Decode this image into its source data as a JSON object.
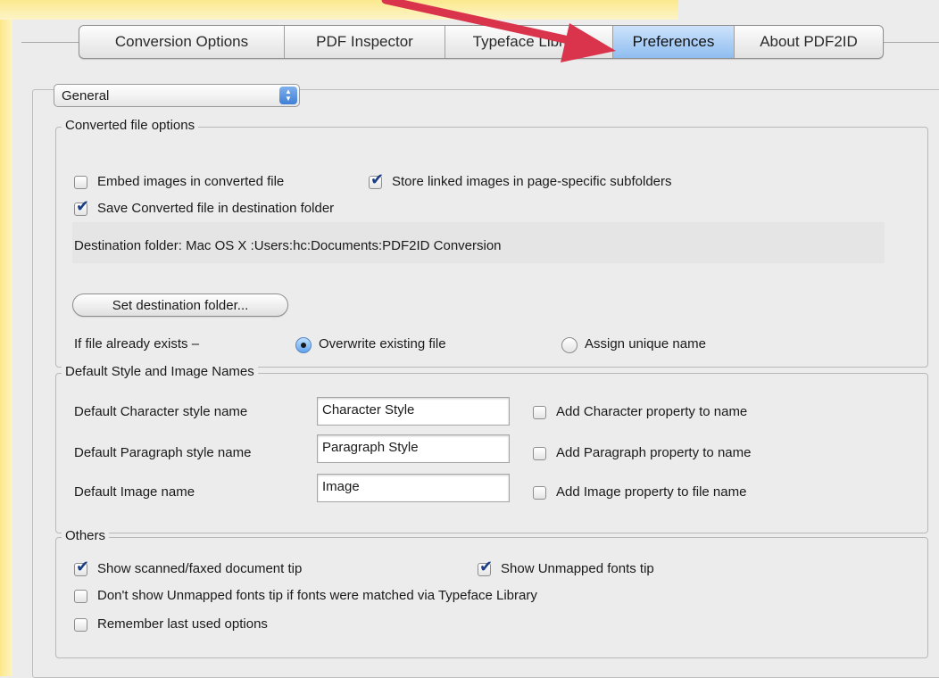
{
  "tabs": [
    {
      "label": "Conversion Options",
      "active": false
    },
    {
      "label": "PDF Inspector",
      "active": false
    },
    {
      "label": "Typeface Library",
      "active": false
    },
    {
      "label": "Preferences",
      "active": true
    },
    {
      "label": "About PDF2ID",
      "active": false
    }
  ],
  "category_popup": {
    "value": "General"
  },
  "converted_file_options": {
    "title": "Converted file options",
    "embed_images": {
      "label": "Embed images in converted file",
      "checked": false
    },
    "store_linked_images": {
      "label": "Store linked images in page-specific subfolders",
      "checked": true
    },
    "save_in_destination": {
      "label": "Save Converted file in destination folder",
      "checked": true
    },
    "destination_folder": "Destination folder: Mac OS X :Users:hc:Documents:PDF2ID Conversion",
    "set_destination_button": "Set destination folder...",
    "if_exists_label": "If file already exists –",
    "overwrite": {
      "label": "Overwrite existing file",
      "selected": true
    },
    "assign_unique": {
      "label": "Assign unique name",
      "selected": false
    }
  },
  "default_names": {
    "title": "Default Style and Image Names",
    "character": {
      "label": "Default Character style name",
      "value": "Character Style",
      "property_label": "Add Character property to name",
      "checked": false
    },
    "paragraph": {
      "label": "Default Paragraph style name",
      "value": "Paragraph Style",
      "property_label": "Add Paragraph property to name",
      "checked": false
    },
    "image": {
      "label": "Default Image name",
      "value": "Image",
      "property_label": "Add Image property to file name",
      "checked": false
    }
  },
  "others": {
    "title": "Others",
    "scanned_tip": {
      "label": "Show scanned/faxed document tip",
      "checked": true
    },
    "unmapped_tip": {
      "label": "Show Unmapped fonts tip",
      "checked": true
    },
    "dont_show_unmapped": {
      "label": "Don't show Unmapped fonts tip if fonts were matched via Typeface Library",
      "checked": false
    },
    "remember_last": {
      "label": "Remember last used options",
      "checked": false
    }
  },
  "colors": {
    "accent_tab": "#8fbdf0",
    "annotation_arrow": "#d9344b",
    "highlight": "#fbe889"
  }
}
